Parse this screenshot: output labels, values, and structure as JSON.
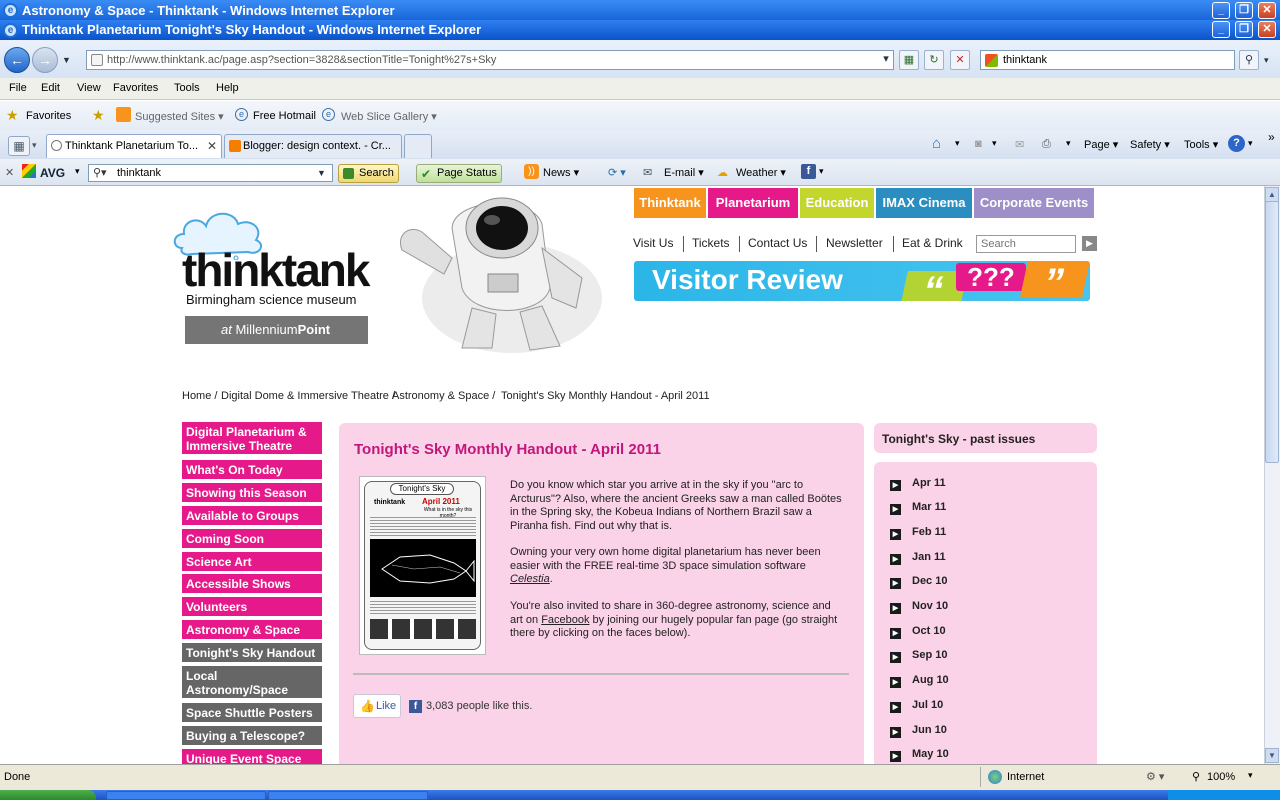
{
  "window_back": {
    "title": "Astronomy & Space - Thinktank - Windows Internet Explorer"
  },
  "window_front": {
    "title": "Thinktank Planetarium Tonight's Sky Handout - Windows Internet Explorer"
  },
  "address": {
    "url": "http://www.thinktank.ac/page.asp?section=3828&sectionTitle=Tonight%27s+Sky"
  },
  "search": {
    "value": "thinktank"
  },
  "menu": [
    "File",
    "Edit",
    "View",
    "Favorites",
    "Tools",
    "Help"
  ],
  "favorites": {
    "label": "Favorites",
    "items": [
      "Suggested Sites",
      "Free Hotmail",
      "Web Slice Gallery"
    ]
  },
  "tabs": [
    {
      "label": "Thinktank Planetarium To..."
    },
    {
      "label": "Blogger: design context. - Cr..."
    }
  ],
  "commands": [
    "Page",
    "Safety",
    "Tools"
  ],
  "avg": {
    "brand": "AVG",
    "search_value": "thinktank",
    "search_btn": "Search",
    "page_status": "Page Status",
    "news": "News",
    "email": "E-mail",
    "weather": "Weather"
  },
  "site": {
    "logo": "thinktank",
    "tagline": "Birmingham science museum",
    "at_label": "at",
    "millennium": "Millennium",
    "point": "Point",
    "top_nav": [
      {
        "label": "Thinktank",
        "color": "#f7941d"
      },
      {
        "label": "Planetarium",
        "color": "#e6198a"
      },
      {
        "label": "Education",
        "color": "#c2d62e"
      },
      {
        "label": "IMAX Cinema",
        "color": "#2a8fc0"
      },
      {
        "label": "Corporate Events",
        "color": "#9e8fc8"
      }
    ],
    "sub_nav": [
      "Visit Us",
      "Tickets",
      "Contact Us",
      "Newsletter",
      "Eat & Drink"
    ],
    "search_placeholder": "Search",
    "banner": {
      "text": "Visitor Review",
      "marks": "???"
    },
    "breadcrumb": [
      "Home /",
      "Digital Dome & Immersive Theatre /",
      "Astronomy & Space /",
      "Tonight's Sky Monthly Handout - April 2011"
    ],
    "sidebar": [
      {
        "label": "Digital Planetarium & Immersive Theatre",
        "gray": false
      },
      {
        "label": "What's On Today",
        "gray": false
      },
      {
        "label": "Showing this Season",
        "gray": false
      },
      {
        "label": "Available to Groups",
        "gray": false
      },
      {
        "label": "Coming Soon",
        "gray": false
      },
      {
        "label": "Science Art",
        "gray": false
      },
      {
        "label": "Accessible Shows",
        "gray": false
      },
      {
        "label": "Volunteers",
        "gray": false
      },
      {
        "label": "Astronomy & Space",
        "gray": false
      },
      {
        "label": "Tonight's Sky Handout",
        "gray": true
      },
      {
        "label": "Local Astronomy/Space",
        "gray": true
      },
      {
        "label": "Space Shuttle Posters",
        "gray": true
      },
      {
        "label": "Buying a Telescope?",
        "gray": true
      },
      {
        "label": "Unique Event Space",
        "gray": false
      }
    ],
    "article": {
      "title": "Tonight's Sky Monthly Handout - April 2011",
      "thumb_title": "Tonight's Sky",
      "thumb_logo": "thinktank",
      "thumb_month": "April 2011",
      "thumb_q": "What is in the sky this month?",
      "p1": "Do you know which star you arrive at in the sky if you \"arc to Arcturus\"? Also, where the ancient Greeks saw a man called Boötes in the Spring sky, the Kobeua Indians of Northern Brazil saw a Piranha fish. Find out why that is.",
      "p2_before": "Owning your very own home digital planetarium has never been easier with the FREE real-time 3D space simulation software ",
      "p2_link": "Celestia",
      "p2_after": ".",
      "p3_before": "You're also invited to share in 360-degree astronomy, science and art on ",
      "p3_link": "Facebook",
      "p3_after": " by joining our hugely popular fan page (go straight there by clicking on the faces below).",
      "like_label": "Like",
      "like_count": "3,083 people like this."
    },
    "past": {
      "title": "Tonight's Sky - past issues",
      "items": [
        "Apr 11",
        "Mar 11",
        "Feb 11",
        "Jan 11",
        "Dec 10",
        "Nov 10",
        "Oct 10",
        "Sep 10",
        "Aug 10",
        "Jul 10",
        "Jun 10",
        "May 10"
      ]
    }
  },
  "status": {
    "text": "Done",
    "zone": "Internet",
    "zoom": "100%"
  }
}
